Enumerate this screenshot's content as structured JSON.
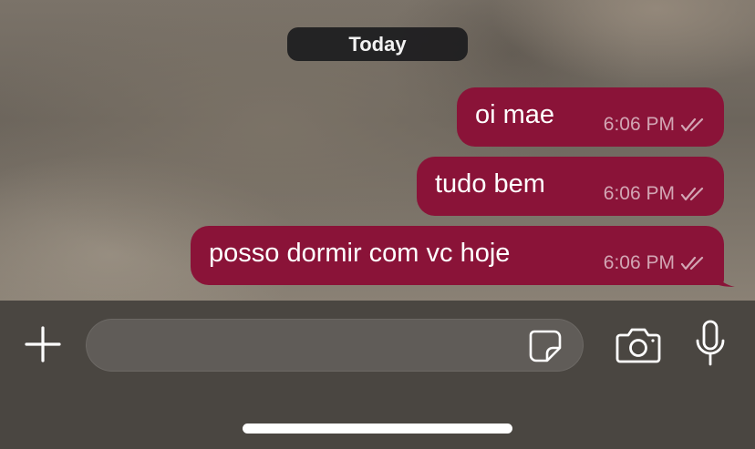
{
  "chat": {
    "date_separator": "Today",
    "messages": [
      {
        "text": "oi mae",
        "time": "6:06 PM",
        "status": "read-double-check"
      },
      {
        "text": "tudo bem",
        "time": "6:06 PM",
        "status": "read-double-check"
      },
      {
        "text": "posso dormir com vc hoje",
        "time": "6:06 PM",
        "status": "read-double-check"
      }
    ]
  },
  "composer": {
    "input_value": "",
    "input_placeholder": "",
    "icons": [
      "plus-icon",
      "sticker-icon",
      "camera-icon",
      "microphone-icon"
    ]
  },
  "colors": {
    "outgoing_bubble": "#8a1338",
    "composer_background": "#4a4641",
    "date_pill": "#1c1c1e"
  }
}
